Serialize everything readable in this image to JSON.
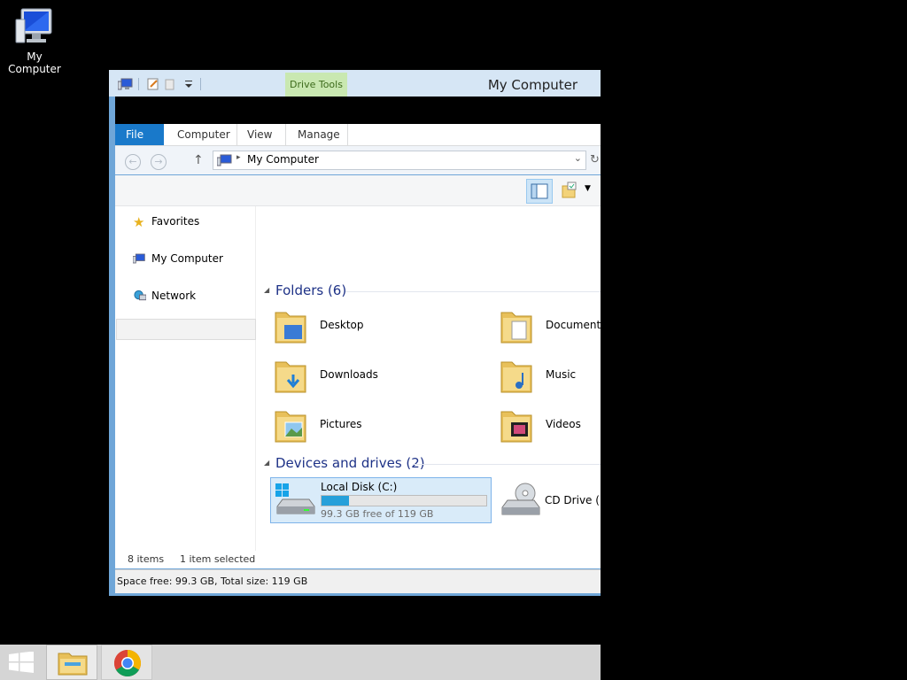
{
  "desktop": {
    "icon_label": "My Computer"
  },
  "window": {
    "title": "My Computer",
    "contextual_tab": "Drive Tools",
    "ribbon_tabs": [
      "File",
      "Computer",
      "View",
      "Manage"
    ],
    "address": "My Computer",
    "navigation": [
      "Favorites",
      "My Computer",
      "Network"
    ],
    "folders_header": "Folders (6)",
    "folders": [
      "Desktop",
      "Documents",
      "Downloads",
      "Music",
      "Pictures",
      "Videos"
    ],
    "devices_header": "Devices and drives (2)",
    "drives": [
      {
        "name": "Local Disk (C:)",
        "free_text": "99.3 GB free of 119 GB",
        "used_fraction": 0.166
      },
      {
        "name": "CD Drive (D:"
      }
    ],
    "status": {
      "items": "8 items",
      "selected": "1 item selected"
    },
    "details": "Space free: 99.3 GB, Total size: 119 GB"
  },
  "taskbar": {
    "apps": [
      "file-explorer-icon",
      "chrome-icon"
    ]
  },
  "colors": {
    "accent": "#1979ca",
    "selection": "#d9ebf9",
    "bar": "#26a0da",
    "section_title": "#1e3287"
  }
}
